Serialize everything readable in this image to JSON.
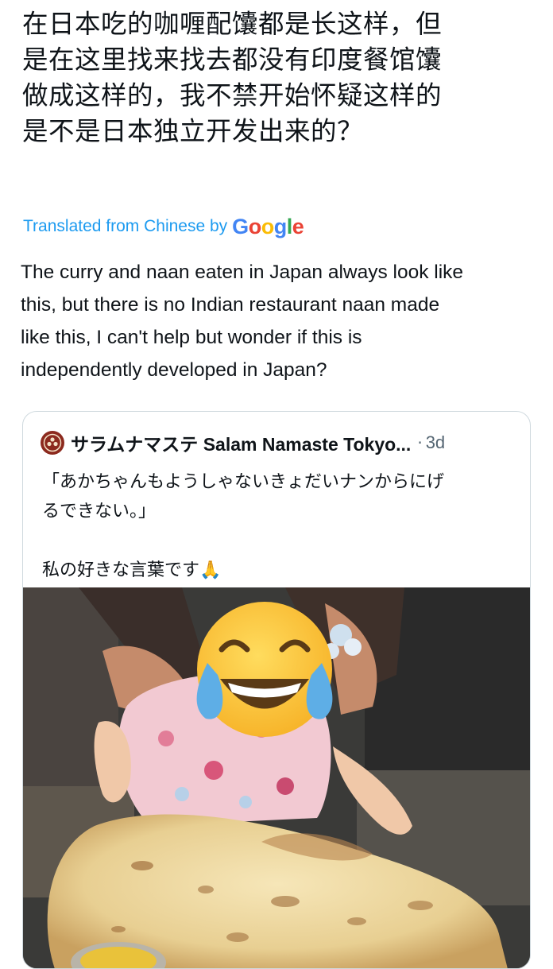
{
  "post": {
    "original_text": "在日本吃的咖喱配馕都是长这样，但\n是在这里找来找去都没有印度餐馆馕\n做成这样的，我不禁开始怀疑这样的\n是不是日本独立开发出来的？",
    "translated_label": "Translated from Chinese by",
    "google_logo": {
      "letters": [
        "G",
        "o",
        "o",
        "g",
        "l",
        "e"
      ],
      "colors": [
        "#4285F4",
        "#EA4335",
        "#FBBC05",
        "#4285F4",
        "#34A853",
        "#EA4335"
      ]
    },
    "translation": "The curry and naan eaten in Japan always look like\nthis, but there is no Indian restaurant naan made\nlike this, I can't help but wonder if this is\nindependently developed in Japan?"
  },
  "quoted_tweet": {
    "avatar_icon": "restaurant-logo-icon",
    "name": "サラムナマステ Salam Namaste Tokyo...",
    "separator": "·",
    "time": "3d",
    "text": "「あかちゃんもようしゃないきょだいナンからにげ\nるできない。」\n\n私の好きな言葉です🙏",
    "image": {
      "icon": "photo-baby-with-giant-naan",
      "emoji": "😂"
    }
  },
  "colors": {
    "text": "#0f1419",
    "secondary_text": "#536471",
    "link_blue": "#1d9bf0",
    "card_border": "#cfd9de"
  }
}
